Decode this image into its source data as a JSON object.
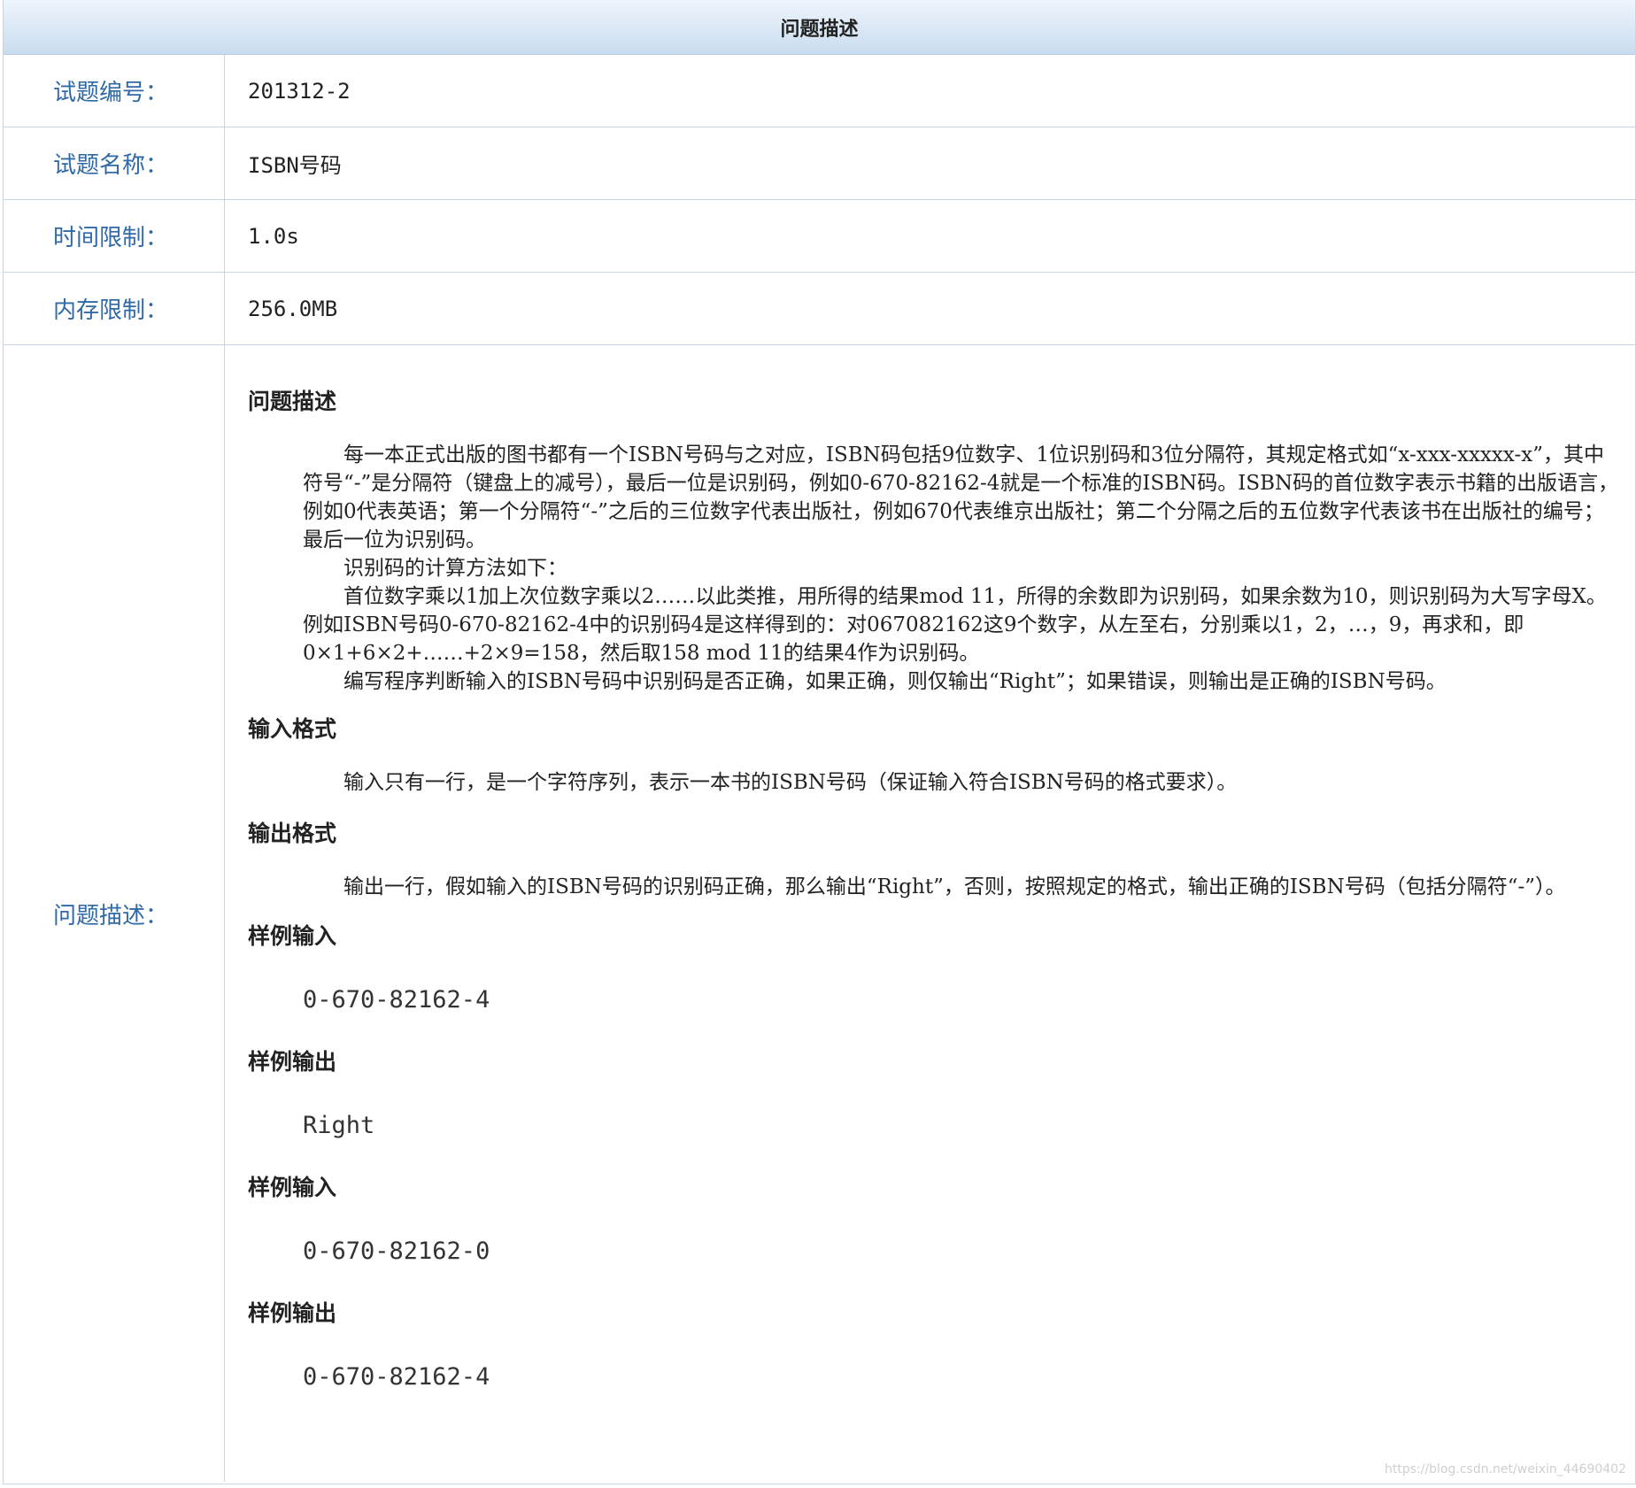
{
  "header": {
    "title": "问题描述"
  },
  "info_rows": [
    {
      "label": "试题编号：",
      "value": "201312-2"
    },
    {
      "label": "试题名称：",
      "value": "ISBN号码"
    },
    {
      "label": "时间限制：",
      "value": "1.0s"
    },
    {
      "label": "内存限制：",
      "value": "256.0MB"
    }
  ],
  "description": {
    "label": "问题描述：",
    "problem_title": "问题描述",
    "problem_paragraphs": [
      "每一本正式出版的图书都有一个ISBN号码与之对应，ISBN码包括9位数字、1位识别码和3位分隔符，其规定格式如“x-xxx-xxxxx-x”，其中符号“-”是分隔符（键盘上的减号），最后一位是识别码，例如0-670-82162-4就是一个标准的ISBN码。ISBN码的首位数字表示书籍的出版语言，例如0代表英语；第一个分隔符“-”之后的三位数字代表出版社，例如670代表维京出版社；第二个分隔之后的五位数字代表该书在出版社的编号；最后一位为识别码。",
      "识别码的计算方法如下：",
      "首位数字乘以1加上次位数字乘以2……以此类推，用所得的结果mod 11，所得的余数即为识别码，如果余数为10，则识别码为大写字母X。例如ISBN号码0-670-82162-4中的识别码4是这样得到的：对067082162这9个数字，从左至右，分别乘以1，2，…，9，再求和，即0×1+6×2+……+2×9=158，然后取158 mod 11的结果4作为识别码。",
      "编写程序判断输入的ISBN号码中识别码是否正确，如果正确，则仅输出“Right”；如果错误，则输出是正确的ISBN号码。"
    ],
    "input_title": "输入格式",
    "input_text": "输入只有一行，是一个字符序列，表示一本书的ISBN号码（保证输入符合ISBN号码的格式要求）。",
    "output_title": "输出格式",
    "output_text": "输出一行，假如输入的ISBN号码的识别码正确，那么输出“Right”，否则，按照规定的格式，输出正确的ISBN号码（包括分隔符“-”）。",
    "samples": [
      {
        "title": "样例输入",
        "value": "0-670-82162-4"
      },
      {
        "title": "样例输出",
        "value": "Right"
      },
      {
        "title": "样例输入",
        "value": "0-670-82162-0"
      },
      {
        "title": "样例输出",
        "value": "0-670-82162-4"
      }
    ]
  },
  "watermark": "https://blog.csdn.net/weixin_44690402"
}
